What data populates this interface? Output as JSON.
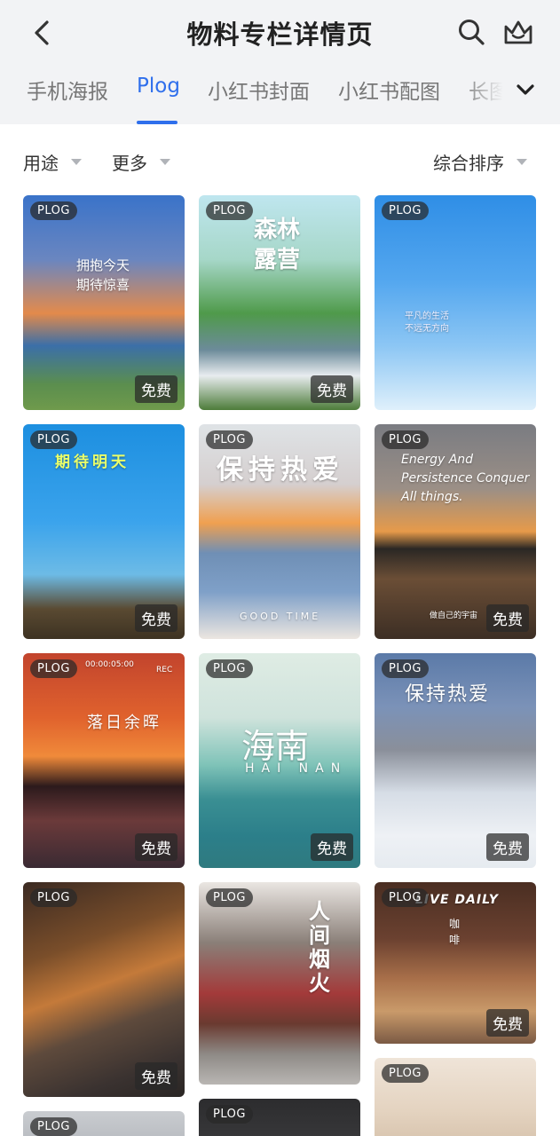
{
  "header": {
    "title": "物料专栏详情页",
    "icons": {
      "back": "chevron-left-icon",
      "search": "search-icon",
      "crown": "crown-icon",
      "more": "chevron-down-icon"
    }
  },
  "tabs": [
    "手机海报",
    "Plog",
    "小红书封面",
    "小红书配图",
    "长图"
  ],
  "active_tab": "Plog",
  "filters": {
    "usage": "用途",
    "more": "更多",
    "sort": "综合排序"
  },
  "badges": {
    "plog": "PLOG",
    "free": "免费"
  },
  "cards": [
    {
      "text": "拥抱今天\n期待惊喜"
    },
    {
      "text": "森林\n露营"
    },
    {
      "text": "平凡的生活\n不远无方向"
    },
    {
      "text": "期待明天"
    },
    {
      "text": "保持热爱",
      "sub": "GOOD TIME"
    },
    {
      "text": "Energy And\nPersistence Conquer\nAll things.",
      "sub": "做自己的宇宙"
    },
    {
      "text": "落日余晖",
      "sub": "00:00:05:00",
      "rec": "REC"
    },
    {
      "text": "海南",
      "sub": "HAI NAN"
    },
    {
      "text": "保持热爱"
    },
    {
      "text": ""
    },
    {
      "text": "人间烟火"
    },
    {
      "text": "LIVE DAILY",
      "sub": "咖啡"
    },
    {
      "text": ""
    },
    {
      "text": ""
    },
    {
      "text": ""
    }
  ],
  "colors": {
    "accent": "#2f6fec",
    "header_bg": "#f2f3f5"
  }
}
